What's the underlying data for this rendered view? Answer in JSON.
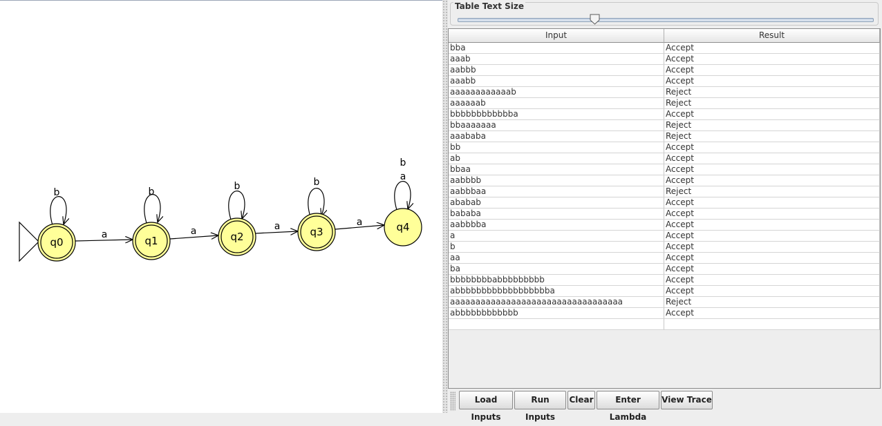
{
  "automaton": {
    "states": [
      {
        "label": "q0",
        "final": true,
        "initial": true
      },
      {
        "label": "q1",
        "final": true,
        "initial": false
      },
      {
        "label": "q2",
        "final": true,
        "initial": false
      },
      {
        "label": "q3",
        "final": true,
        "initial": false
      },
      {
        "label": "q4",
        "final": false,
        "initial": false
      }
    ],
    "transitions": [
      {
        "from": "q0",
        "to": "q0",
        "label": "b"
      },
      {
        "from": "q0",
        "to": "q1",
        "label": "a"
      },
      {
        "from": "q1",
        "to": "q1",
        "label": "b"
      },
      {
        "from": "q1",
        "to": "q2",
        "label": "a"
      },
      {
        "from": "q2",
        "to": "q2",
        "label": "b"
      },
      {
        "from": "q2",
        "to": "q3",
        "label": "a"
      },
      {
        "from": "q3",
        "to": "q3",
        "label": "b"
      },
      {
        "from": "q3",
        "to": "q4",
        "label": "a"
      },
      {
        "from": "q4",
        "to": "q4",
        "label": "b"
      },
      {
        "from": "q4",
        "to": "q4",
        "label": "a"
      }
    ],
    "state_fill": "#ffff99"
  },
  "slider": {
    "title": "Table Text Size",
    "value_fraction": 0.33
  },
  "table": {
    "headers": {
      "input": "Input",
      "result": "Result"
    },
    "rows": [
      {
        "input": "bba",
        "result": "Accept"
      },
      {
        "input": "aaab",
        "result": "Accept"
      },
      {
        "input": "aabbb",
        "result": "Accept"
      },
      {
        "input": "aaabb",
        "result": "Accept"
      },
      {
        "input": "aaaaaaaaaaaab",
        "result": "Reject"
      },
      {
        "input": "aaaaaab",
        "result": "Reject"
      },
      {
        "input": "bbbbbbbbbbbba",
        "result": "Accept"
      },
      {
        "input": "bbaaaaaaa",
        "result": "Reject"
      },
      {
        "input": "aaababa",
        "result": "Reject"
      },
      {
        "input": "bb",
        "result": "Accept"
      },
      {
        "input": "ab",
        "result": "Accept"
      },
      {
        "input": "bbaa",
        "result": "Accept"
      },
      {
        "input": "aabbbb",
        "result": "Accept"
      },
      {
        "input": "aabbbaa",
        "result": "Reject"
      },
      {
        "input": "ababab",
        "result": "Accept"
      },
      {
        "input": "bababa",
        "result": "Accept"
      },
      {
        "input": "aabbbba",
        "result": "Accept"
      },
      {
        "input": "a",
        "result": "Accept"
      },
      {
        "input": "b",
        "result": "Accept"
      },
      {
        "input": "aa",
        "result": "Accept"
      },
      {
        "input": "ba",
        "result": "Accept"
      },
      {
        "input": "bbbbbbbbabbbbbbbbb",
        "result": "Accept"
      },
      {
        "input": "abbbbbbbbbbbbbbbbbba",
        "result": "Accept"
      },
      {
        "input": "aaaaaaaaaaaaaaaaaaaaaaaaaaaaaaaaaa",
        "result": "Reject"
      },
      {
        "input": "abbbbbbbbbbbb",
        "result": "Accept"
      },
      {
        "input": "",
        "result": ""
      }
    ]
  },
  "buttons": {
    "load_inputs": "Load Inputs",
    "run_inputs": "Run Inputs",
    "clear": "Clear",
    "enter_lambda": "Enter Lambda",
    "view_trace": "View Trace"
  }
}
